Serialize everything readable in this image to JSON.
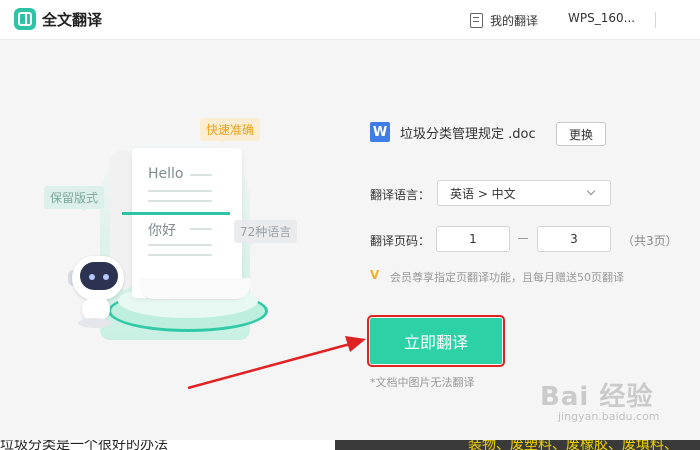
{
  "titlebar": {
    "app_title": "全文翻译",
    "my_translations": "我的翻译",
    "account": "WPS_160..."
  },
  "illustration": {
    "tag_fast": "快速准确",
    "tag_keep_format": "保留版式",
    "tag_languages": "72种语言",
    "hello": "Hello",
    "nihao": "你好"
  },
  "file": {
    "icon_letter": "W",
    "name": "垃圾分类管理规定 .doc",
    "change_label": "更换"
  },
  "language": {
    "label": "翻译语言：",
    "value": "英语 > 中文"
  },
  "pages": {
    "label": "翻译页码：",
    "from": "1",
    "to": "3",
    "total": "（共3页）"
  },
  "vip": {
    "text": "会员尊享指定页翻译功能，且每月赠送50页翻译"
  },
  "translate_button": "立即翻译",
  "note": "*文档中图片无法翻译",
  "watermark": {
    "text": "Bai 经验",
    "url": "jingyan.baidu.com"
  },
  "bottom": {
    "left_text": "垃圾分类是一个很好的办法",
    "right_text": "装物、废塑料、废橡胶、废填料、"
  },
  "colors": {
    "accent": "#2dd1a6",
    "annotation_red": "#e02222"
  }
}
